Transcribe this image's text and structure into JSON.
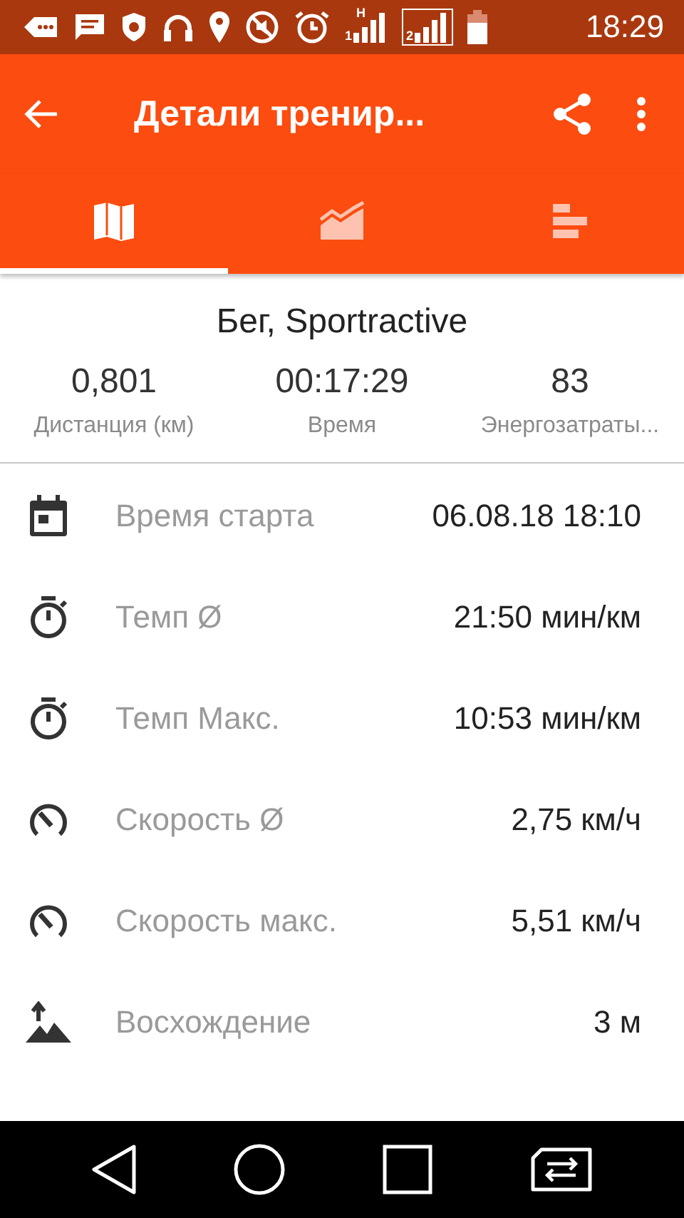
{
  "status_bar": {
    "sim_1": "1",
    "network": "H",
    "sim_2": "2",
    "time": "18:29"
  },
  "toolbar": {
    "title": "Детали тренир..."
  },
  "tabs": [
    {
      "kind": "map",
      "selected": true
    },
    {
      "kind": "chart",
      "selected": false
    },
    {
      "kind": "bars",
      "selected": false
    }
  ],
  "summary": {
    "title": "Бег, Sportractive",
    "stats": [
      {
        "value": "0,801",
        "label": "Дистанция (км)"
      },
      {
        "value": "00:17:29",
        "label": "Время"
      },
      {
        "value": "83",
        "label": "Энергозатраты..."
      }
    ]
  },
  "details": [
    {
      "kind": "calendar",
      "label": "Время старта",
      "value": "06.08.18 18:10"
    },
    {
      "kind": "stopwatch",
      "label": "Темп Ø",
      "value": "21:50 мин/км"
    },
    {
      "kind": "stopwatch",
      "label": "Темп Макс.",
      "value": "10:53 мин/км"
    },
    {
      "kind": "speedometer",
      "label": "Скорость Ø",
      "value": "2,75 км/ч"
    },
    {
      "kind": "speedometer",
      "label": "Скорость макс.",
      "value": "5,51 км/ч"
    },
    {
      "kind": "ascent",
      "label": "Восхождение",
      "value": "3 м"
    }
  ]
}
